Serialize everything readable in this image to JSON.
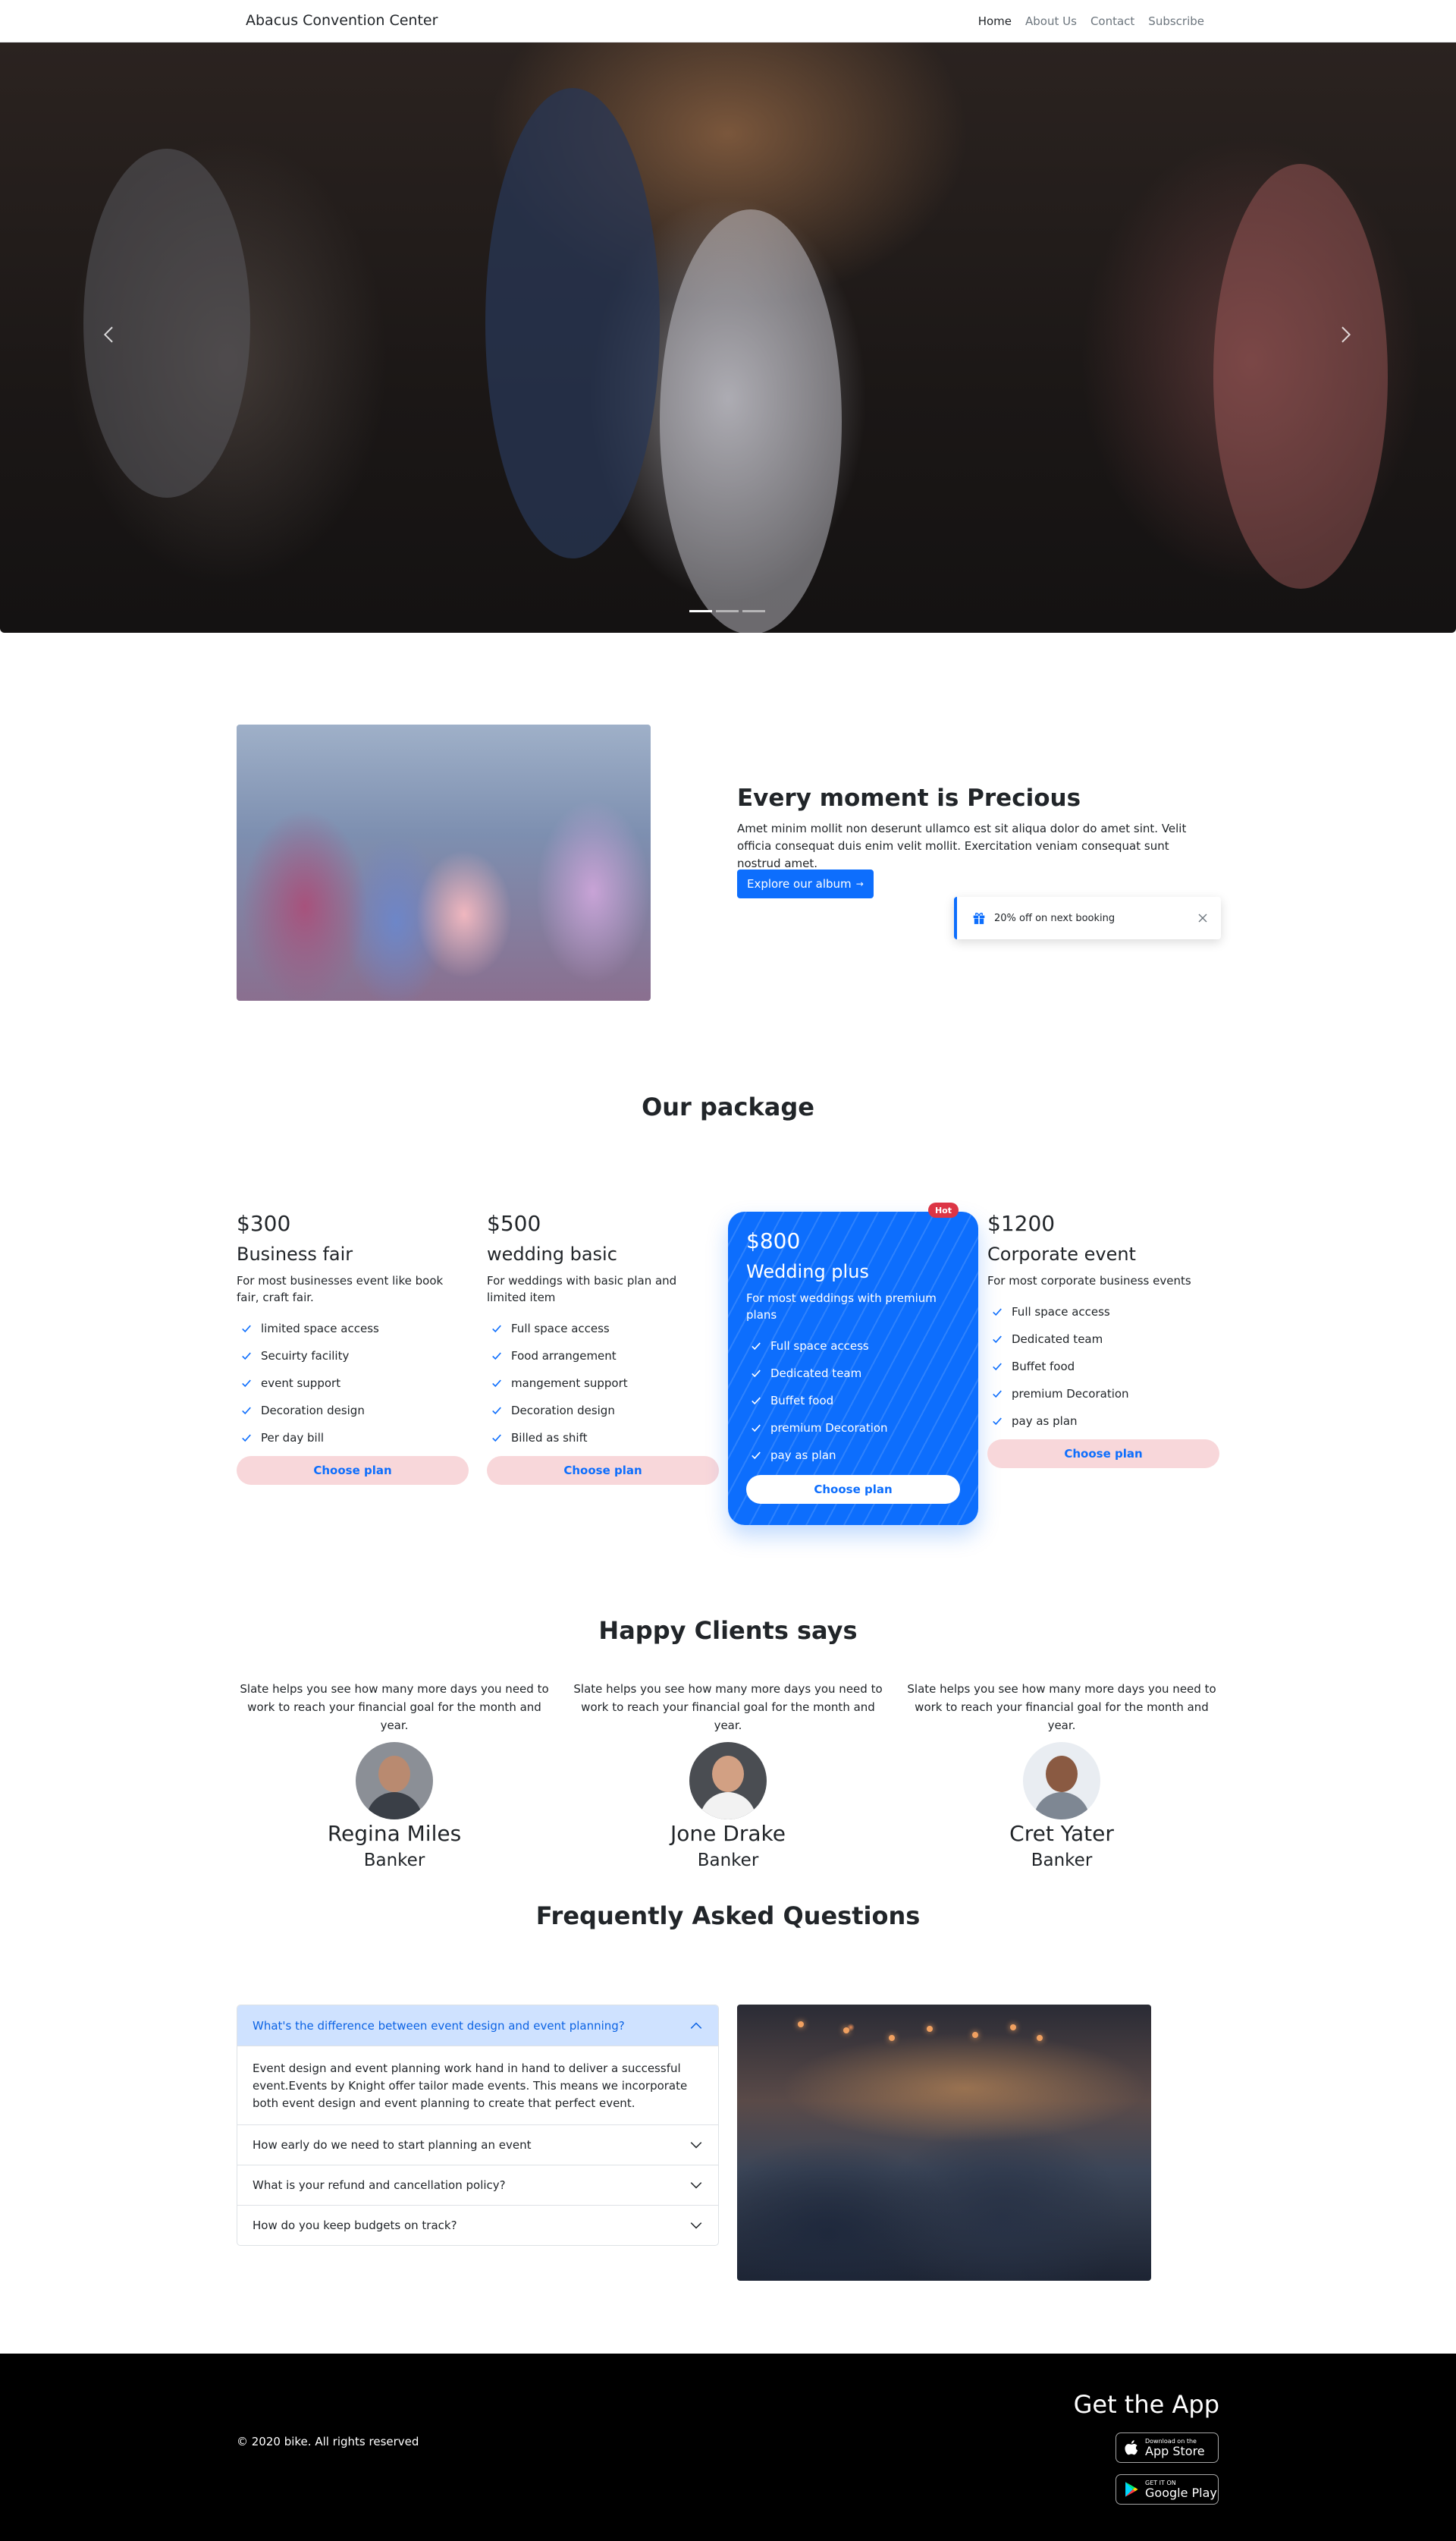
{
  "navbar": {
    "brand": "Abacus Convention Center",
    "links": [
      "Home",
      "About Us",
      "Contact",
      "Subscribe"
    ]
  },
  "hero": {
    "slide_count": 3,
    "active_slide": 1
  },
  "about": {
    "title": "Every moment is Precious",
    "text": "Amet minim mollit non deserunt ullamco est sit aliqua dolor do amet sint. Velit officia consequat duis enim velit mollit. Exercitation veniam consequat sunt nostrud amet.",
    "button": "Explore our album",
    "button_arrow": "→",
    "toast": "20% off on next booking"
  },
  "packages": {
    "title": "Our package",
    "plans": [
      {
        "price": "$300",
        "name": "Business fair",
        "desc": "For most businesses event like book fair, craft fair.",
        "features": [
          "limited space access",
          "Secuirty facility",
          "event support",
          "Decoration design",
          "Per day bill"
        ],
        "cta": "Choose plan"
      },
      {
        "price": "$500",
        "name": "wedding basic",
        "desc": "For weddings with basic plan and limited item",
        "features": [
          "Full space access",
          "Food arrangement",
          "mangement support",
          "Decoration design",
          "Billed as shift"
        ],
        "cta": "Choose plan"
      },
      {
        "price": "$800",
        "name": "Wedding plus",
        "desc": "For most weddings with premium plans",
        "features": [
          "Full space access",
          "Dedicated team",
          "Buffet food",
          "premium Decoration",
          "pay as plan"
        ],
        "cta": "Choose plan",
        "badge": "Hot"
      },
      {
        "price": "$1200",
        "name": "Corporate event",
        "desc": "For most corporate business events",
        "features": [
          "Full space access",
          "Dedicated team",
          "Buffet food",
          "premium Decoration",
          "pay as plan"
        ],
        "cta": "Choose plan"
      }
    ]
  },
  "clients": {
    "title": "Happy Clients says",
    "items": [
      {
        "quote": "Slate helps you see how many more days you need to work to reach your financial goal for the month and year.",
        "name": "Regina Miles",
        "role": "Banker"
      },
      {
        "quote": "Slate helps you see how many more days you need to work to reach your financial goal for the month and year.",
        "name": "Jone Drake",
        "role": "Banker"
      },
      {
        "quote": "Slate helps you see how many more days you need to work to reach your financial goal for the month and year.",
        "name": "Cret Yater",
        "role": "Banker"
      }
    ]
  },
  "faq": {
    "title": "Frequently Asked Questions",
    "items": [
      {
        "q": "What's the difference between event design and event planning?",
        "a": "Event design and event planning work hand in hand to deliver a successful event.Events by Knight offer tailor made events. This means we incorporate both event design and event planning to create that perfect event."
      },
      {
        "q": "How early do we need to start planning an event"
      },
      {
        "q": "What is your refund and cancellation policy?"
      },
      {
        "q": "How do you keep budgets on track?"
      }
    ]
  },
  "footer": {
    "copyright": "© 2020 bike. All rights reserved",
    "get_app": "Get the App",
    "app_store_small": "Download on the",
    "app_store_big": "App Store",
    "play_small": "GET IT ON",
    "play_big": "Google Play"
  },
  "colors": {
    "primary": "#0d6efd",
    "choose_bg": "#f8d7da",
    "hot": "#dc3545",
    "faq_open_bg": "#cfe2ff",
    "footer_bg": "#000000"
  },
  "icons": [
    "chevron-left-icon",
    "chevron-right-icon",
    "arrow-right-icon",
    "gift-icon",
    "close-icon",
    "check-icon",
    "chevron-up-icon",
    "chevron-down-icon",
    "apple-icon",
    "google-play-icon"
  ]
}
